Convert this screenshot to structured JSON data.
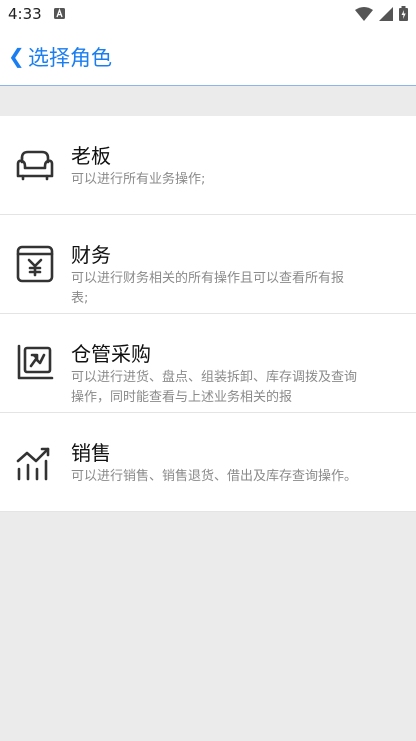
{
  "status": {
    "time": "4:33"
  },
  "nav": {
    "back_icon": "chevron-left-icon",
    "title": "选择角色"
  },
  "roles": [
    {
      "name": "老板",
      "desc": "可以进行所有业务操作;",
      "icon": "sofa-icon"
    },
    {
      "name": "财务",
      "desc": "可以进行财务相关的所有操作且可以查看所有报表;",
      "icon": "finance-ledger-icon"
    },
    {
      "name": "仓管采购",
      "desc": "可以进行进货、盘点、组装拆卸、库存调拨及查询操作，同时能查看与上述业务相关的报",
      "icon": "warehouse-chart-icon"
    },
    {
      "name": "销售",
      "desc": "可以进行销售、销售退货、借出及库存查询操作。",
      "icon": "sales-trend-icon"
    }
  ],
  "colors": {
    "accent": "#1a7ef0",
    "background": "#ebebeb"
  }
}
